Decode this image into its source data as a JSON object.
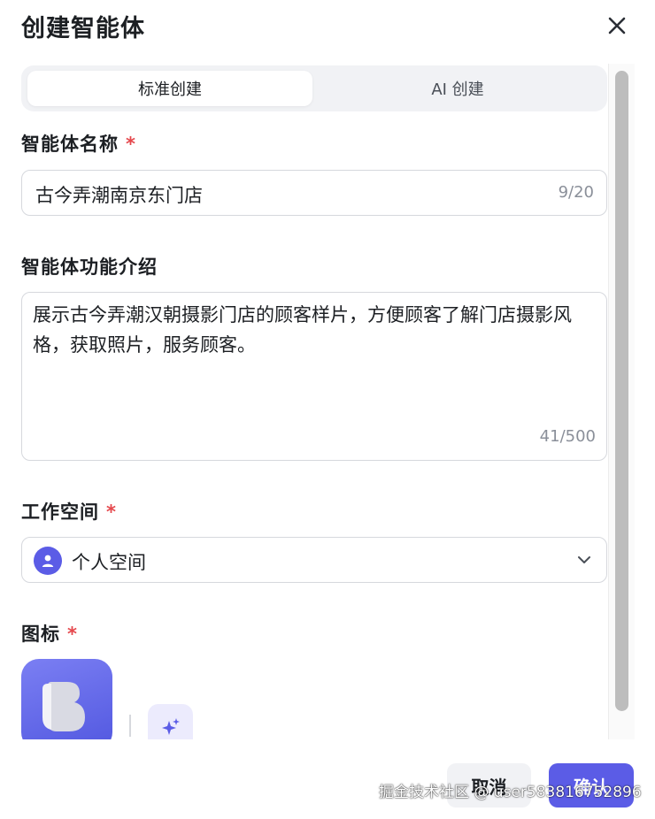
{
  "dialog": {
    "title": "创建智能体"
  },
  "tabs": [
    {
      "label": "标准创建",
      "active": true
    },
    {
      "label": "AI 创建",
      "active": false
    }
  ],
  "form": {
    "name": {
      "label": "智能体名称",
      "required_mark": "*",
      "value": "古今弄潮南京东门店",
      "counter": "9/20"
    },
    "description": {
      "label": "智能体功能介绍",
      "value": "展示古今弄潮汉朝摄影门店的顾客样片，方便顾客了解门店摄影风格，获取照片，服务顾客。",
      "counter": "41/500"
    },
    "workspace": {
      "label": "工作空间",
      "required_mark": "*",
      "value": "个人空间",
      "icon": "user-avatar-icon"
    },
    "icon_field": {
      "label": "图标",
      "required_mark": "*"
    }
  },
  "footer": {
    "cancel_label": "取消",
    "confirm_label": "确认"
  },
  "watermark": "掘金技术社区 @ user583816752896",
  "colors": {
    "accent": "#5b5ce6",
    "required": "#e5484d",
    "muted_text": "#8a8f99",
    "border": "#d6d8dd"
  }
}
